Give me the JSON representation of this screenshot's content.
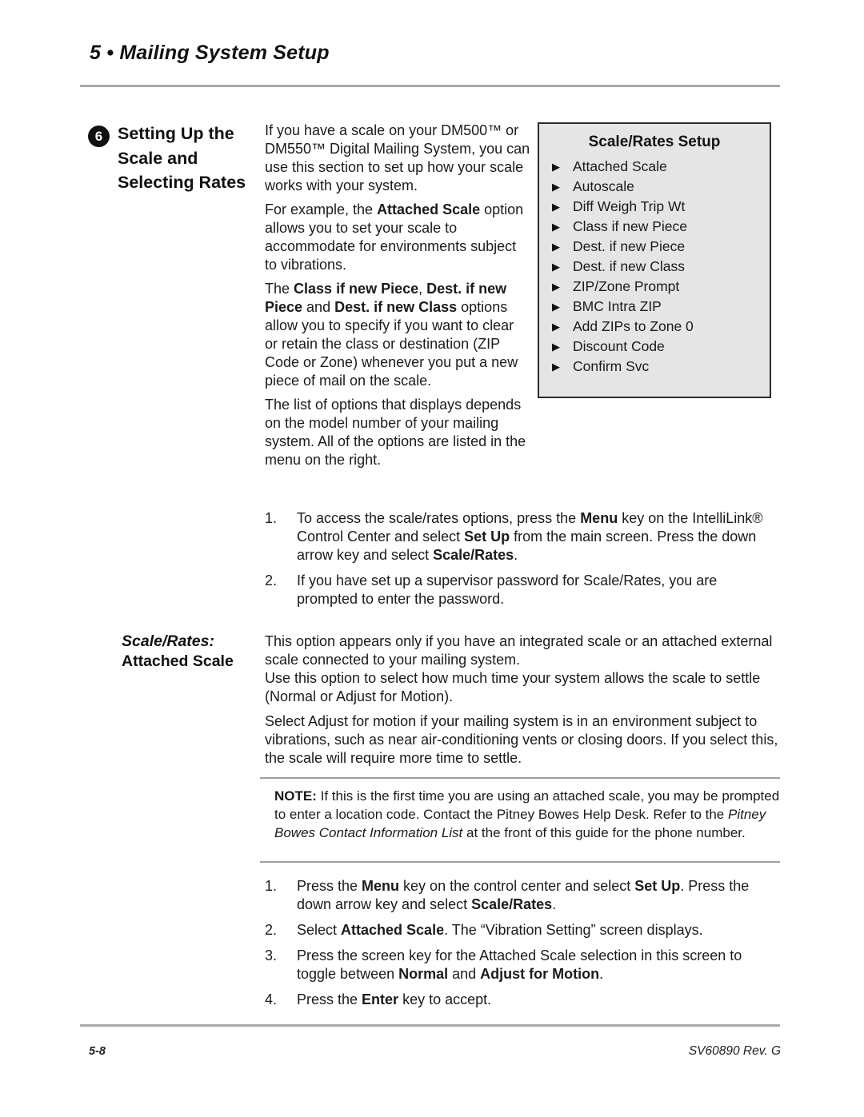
{
  "header": {
    "chapter_title": "5 • Mailing System Setup"
  },
  "section": {
    "badge_number": "6",
    "title": "Setting Up the Scale and Selecting Rates"
  },
  "intro": {
    "paragraph_1_parts": [
      {
        "text": "If you have a scale on your DM500™ or DM550™ Digital Mailing System, you can use this section to set up how your scale works with your system.",
        "style": "normal"
      }
    ],
    "paragraph_2_parts": [
      {
        "text": "For example, the ",
        "style": "normal"
      },
      {
        "text": "Attached Scale",
        "style": "bold"
      },
      {
        "text": " option allows you to set your scale to accommodate for environments subject to vibrations.",
        "style": "normal"
      }
    ],
    "paragraph_3_parts": [
      {
        "text": "The ",
        "style": "normal"
      },
      {
        "text": "Class if new Piece",
        "style": "bold"
      },
      {
        "text": ", ",
        "style": "normal"
      },
      {
        "text": "Dest. if new Piece",
        "style": "bold"
      },
      {
        "text": " and ",
        "style": "normal"
      },
      {
        "text": "Dest. if new Class",
        "style": "bold"
      },
      {
        "text": " options allow you to specify if you want to clear or retain the class or destination (ZIP Code or Zone) whenever you put a new piece of mail on the scale.",
        "style": "normal"
      }
    ],
    "paragraph_4_parts": [
      {
        "text": "The list of options that displays depends on the model number of your mailing system. All of the options are listed in the menu on the right.",
        "style": "normal"
      }
    ]
  },
  "menu_box": {
    "title": "Scale/Rates Setup",
    "arrow_glyph": "▶",
    "items": [
      {
        "label": "Attached Scale"
      },
      {
        "label": "Autoscale"
      },
      {
        "label": "Diff Weigh Trip Wt"
      },
      {
        "label": "Class if new Piece"
      },
      {
        "label": "Dest. if new Piece"
      },
      {
        "label": "Dest. if new Class"
      },
      {
        "label": "ZIP/Zone Prompt"
      },
      {
        "label": "BMC Intra ZIP"
      },
      {
        "label": "Add ZIPs to Zone 0"
      },
      {
        "label": "Discount Code"
      },
      {
        "label": "Confirm Svc"
      }
    ],
    "background_color": "#e5e5e5",
    "border_color": "#2b2b2b"
  },
  "steps_access": [
    {
      "number": "1.",
      "parts": [
        {
          "text": "To access the scale/rates options, press the ",
          "style": "normal"
        },
        {
          "text": "Menu",
          "style": "bold"
        },
        {
          "text": " key on the IntelliLink® Control Center and select ",
          "style": "normal"
        },
        {
          "text": "Set Up",
          "style": "bold"
        },
        {
          "text": " from the main screen. Press the down arrow key and select ",
          "style": "normal"
        },
        {
          "text": "Scale/Rates",
          "style": "bold"
        },
        {
          "text": ".",
          "style": "normal"
        }
      ]
    },
    {
      "number": "2.",
      "parts": [
        {
          "text": "If you have set up a supervisor password for Scale/Rates, you are prompted to enter the password.",
          "style": "normal"
        }
      ]
    }
  ],
  "subsection": {
    "label_line1": "Scale/Rates:",
    "label_line2": "Attached Scale",
    "paragraph_1_parts": [
      {
        "text": "This option appears only if you have an integrated scale or an attached external scale connected to your mailing system.",
        "style": "normal"
      }
    ],
    "paragraph_2_parts": [
      {
        "text": "Use this option to select how much time your system allows the scale to settle (Normal or Adjust for Motion).",
        "style": "normal"
      }
    ],
    "paragraph_3_parts": [
      {
        "text": "Select Adjust for motion if your mailing system is in an environment subject to vibrations, such as near air-conditioning vents or closing doors. If you select this, the scale will require more time to settle.",
        "style": "normal"
      }
    ]
  },
  "note": {
    "parts": [
      {
        "text": "NOTE:",
        "style": "bold"
      },
      {
        "text": "  If this is the first time you are using an attached scale, you may be prompted to enter a location code. Contact the Pitney Bowes Help Desk. Refer to the ",
        "style": "normal"
      },
      {
        "text": "Pitney Bowes Contact Information List",
        "style": "italic"
      },
      {
        "text": " at the front of this guide for the phone number.",
        "style": "normal"
      }
    ]
  },
  "steps_procedure": [
    {
      "number": "1.",
      "parts": [
        {
          "text": "Press the ",
          "style": "normal"
        },
        {
          "text": "Menu",
          "style": "bold"
        },
        {
          "text": " key on the control center and select ",
          "style": "normal"
        },
        {
          "text": "Set Up",
          "style": "bold"
        },
        {
          "text": ". Press the down arrow key and select ",
          "style": "normal"
        },
        {
          "text": "Scale/Rates",
          "style": "bold"
        },
        {
          "text": ".",
          "style": "normal"
        }
      ]
    },
    {
      "number": "2.",
      "parts": [
        {
          "text": "Select ",
          "style": "normal"
        },
        {
          "text": "Attached Scale",
          "style": "bold"
        },
        {
          "text": ". The “Vibration Setting” screen displays.",
          "style": "normal"
        }
      ]
    },
    {
      "number": "3.",
      "parts": [
        {
          "text": "Press the screen key for the Attached Scale selection in this screen to toggle between ",
          "style": "normal"
        },
        {
          "text": "Normal",
          "style": "bold"
        },
        {
          "text": " and ",
          "style": "normal"
        },
        {
          "text": "Adjust for Motion",
          "style": "bold"
        },
        {
          "text": ".",
          "style": "normal"
        }
      ]
    },
    {
      "number": "4.",
      "parts": [
        {
          "text": "Press the ",
          "style": "normal"
        },
        {
          "text": "Enter",
          "style": "bold"
        },
        {
          "text": " key to accept.",
          "style": "normal"
        }
      ]
    }
  ],
  "footer": {
    "page_number": "5-8",
    "document_id": "SV60890 Rev. G"
  }
}
